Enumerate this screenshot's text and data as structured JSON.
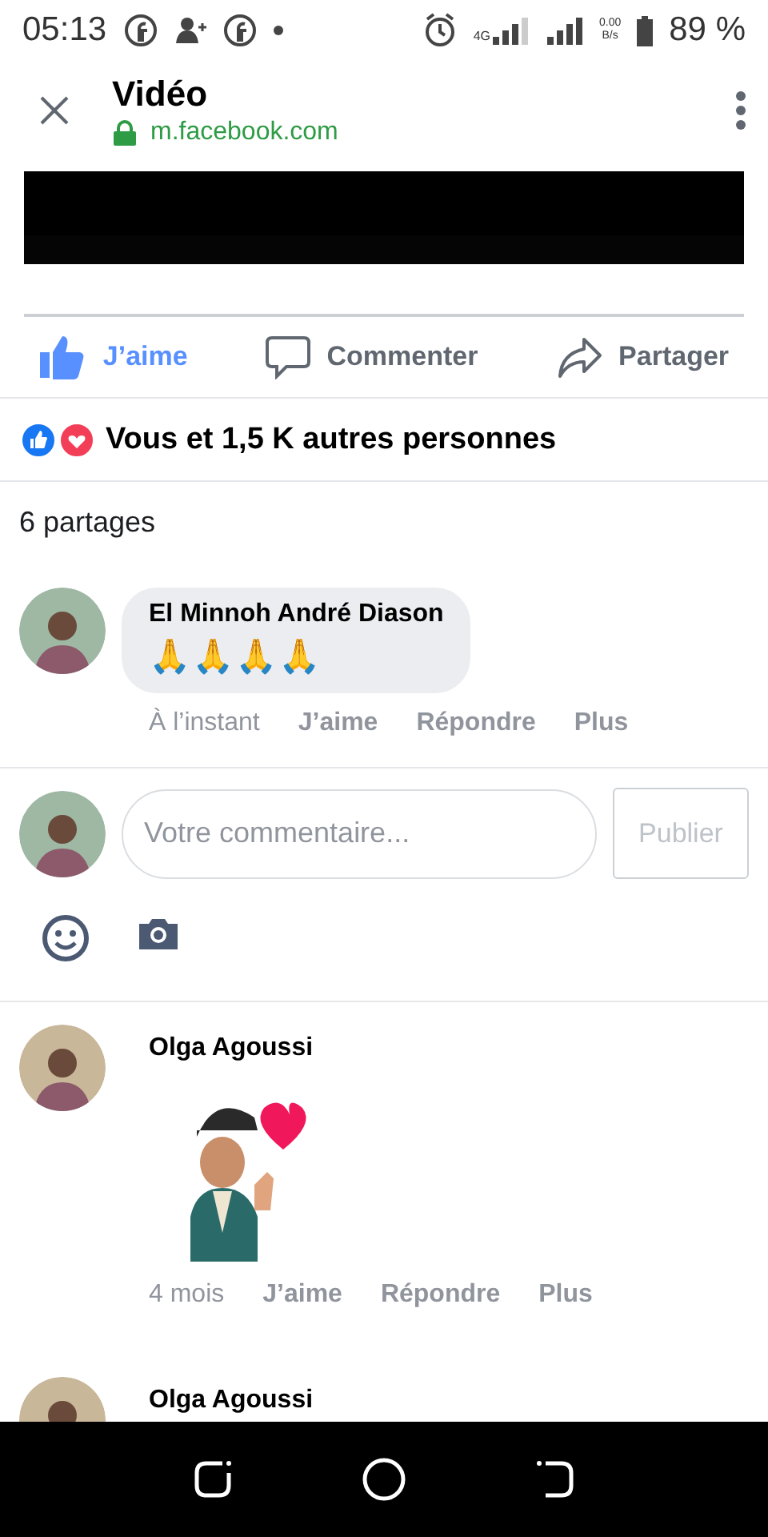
{
  "status_bar": {
    "time": "05:13",
    "network": "4G",
    "speed_value": "0.00",
    "speed_unit": "B/s",
    "battery": "89 %"
  },
  "header": {
    "title": "Vidéo",
    "url": "m.facebook.com"
  },
  "actions": [
    {
      "kind": "like",
      "label": "J’aime",
      "selected": true
    },
    {
      "kind": "comment",
      "label": "Commenter",
      "selected": false
    },
    {
      "kind": "share",
      "label": "Partager",
      "selected": false
    }
  ],
  "reactions": {
    "summary": "Vous et 1,5 K autres personnes"
  },
  "shares": "6 partages",
  "comments": [
    {
      "kind": "text",
      "author": "El Minnoh André Diason",
      "body": "🙏🙏🙏🙏",
      "time": "À l’instant",
      "actions": [
        "J’aime",
        "Répondre",
        "Plus"
      ]
    },
    {
      "kind": "composer",
      "placeholder": "Votre commentaire...",
      "button": "Publier",
      "disabled": true
    },
    {
      "kind": "sticker",
      "author": "Olga Agoussi",
      "time": "4 mois",
      "actions": [
        "J’aime",
        "Répondre",
        "Plus"
      ]
    },
    {
      "kind": "cut",
      "author": "Olga Agoussi"
    }
  ]
}
